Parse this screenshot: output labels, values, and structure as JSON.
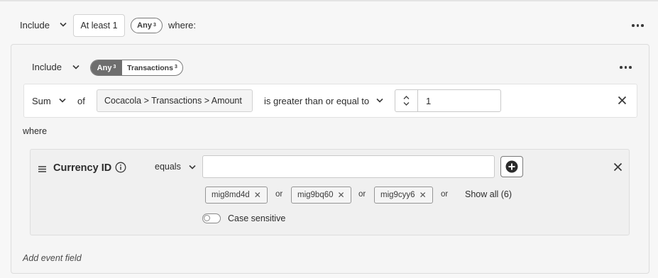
{
  "top_row": {
    "include_label": "Include",
    "atleast_label": "At least 1",
    "any_label": "Any",
    "any_sup": "3",
    "where_label": "where:"
  },
  "event_card": {
    "include_label": "Include",
    "any_label": "Any",
    "any_sup": "3",
    "transactions_label": "Transactions",
    "transactions_sup": "3",
    "aggregate": {
      "function_label": "Sum",
      "of_label": "of",
      "field_path": "Cocacola > Transactions > Amount",
      "operator_label": "is greater than or equal to",
      "value": "1"
    },
    "where_label": "where",
    "filter": {
      "name": "Currency ID",
      "operator_label": "equals",
      "input_value": "",
      "tags": [
        {
          "label": "mig8md4d"
        },
        {
          "label": "mig9bq60"
        },
        {
          "label": "mig9cyy6"
        }
      ],
      "or_label": "or",
      "show_all_label": "Show all (6)",
      "case_sensitive_label": "Case sensitive",
      "case_sensitive": false
    },
    "add_event_field_label": "Add event field"
  }
}
